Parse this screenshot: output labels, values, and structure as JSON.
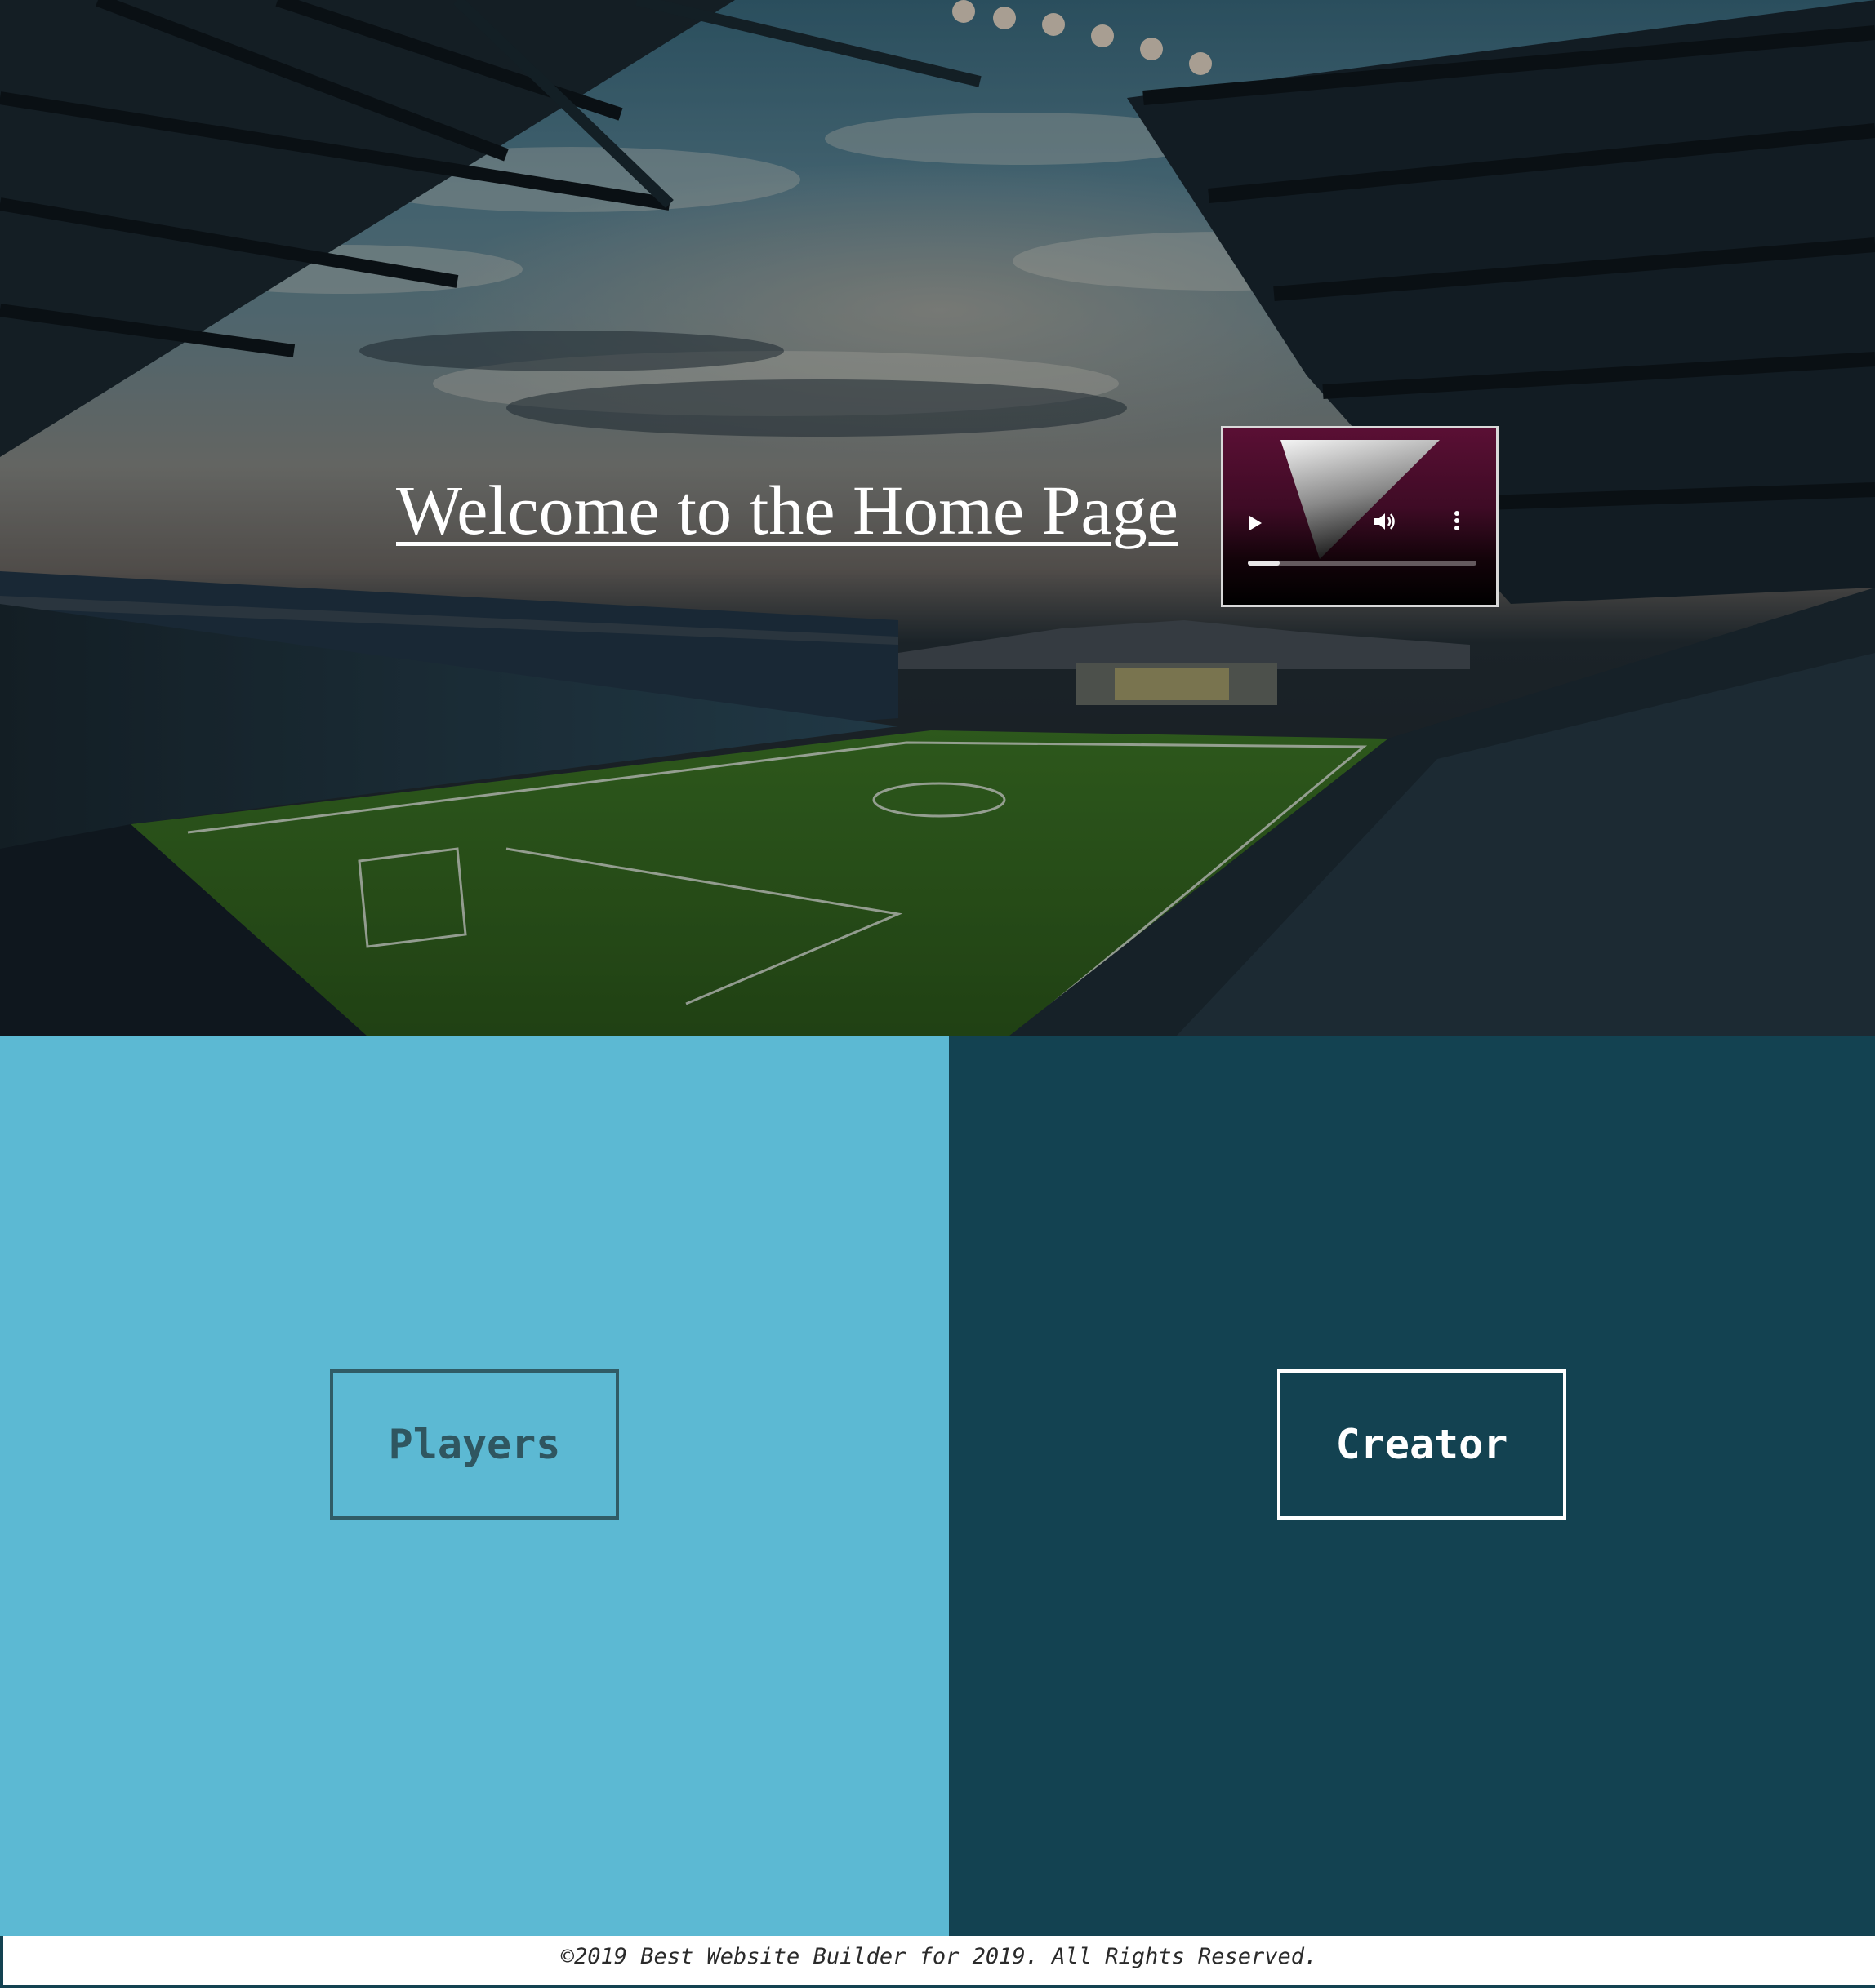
{
  "hero": {
    "heading": "Welcome to the Home Page",
    "background_description_icon": "stadium-photo"
  },
  "video_player": {
    "play_icon": "play-icon",
    "volume_icon": "volume-icon",
    "more_icon": "more-options-icon",
    "progress_fraction": 0.14
  },
  "panels": {
    "left": {
      "button_label": "Players",
      "bg_color": "#5cb9d3",
      "text_color": "#2f5660"
    },
    "right": {
      "button_label": "Creator",
      "bg_color": "#134251",
      "text_color": "#ffffff"
    }
  },
  "footer": {
    "copyright": "©2019 Best Website Builder for 2019. All Rights Reserved."
  }
}
